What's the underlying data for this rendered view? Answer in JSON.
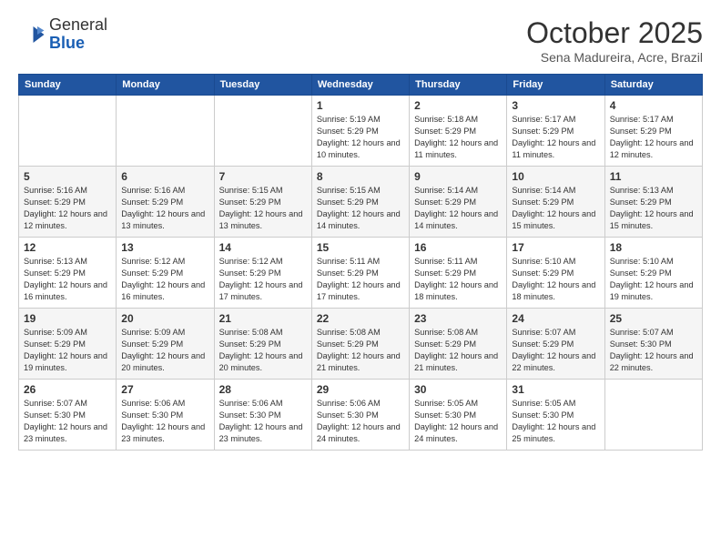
{
  "header": {
    "logo_general": "General",
    "logo_blue": "Blue",
    "month": "October 2025",
    "location": "Sena Madureira, Acre, Brazil"
  },
  "days_of_week": [
    "Sunday",
    "Monday",
    "Tuesday",
    "Wednesday",
    "Thursday",
    "Friday",
    "Saturday"
  ],
  "weeks": [
    [
      {
        "day": "",
        "info": ""
      },
      {
        "day": "",
        "info": ""
      },
      {
        "day": "",
        "info": ""
      },
      {
        "day": "1",
        "info": "Sunrise: 5:19 AM\nSunset: 5:29 PM\nDaylight: 12 hours and 10 minutes."
      },
      {
        "day": "2",
        "info": "Sunrise: 5:18 AM\nSunset: 5:29 PM\nDaylight: 12 hours and 11 minutes."
      },
      {
        "day": "3",
        "info": "Sunrise: 5:17 AM\nSunset: 5:29 PM\nDaylight: 12 hours and 11 minutes."
      },
      {
        "day": "4",
        "info": "Sunrise: 5:17 AM\nSunset: 5:29 PM\nDaylight: 12 hours and 12 minutes."
      }
    ],
    [
      {
        "day": "5",
        "info": "Sunrise: 5:16 AM\nSunset: 5:29 PM\nDaylight: 12 hours and 12 minutes."
      },
      {
        "day": "6",
        "info": "Sunrise: 5:16 AM\nSunset: 5:29 PM\nDaylight: 12 hours and 13 minutes."
      },
      {
        "day": "7",
        "info": "Sunrise: 5:15 AM\nSunset: 5:29 PM\nDaylight: 12 hours and 13 minutes."
      },
      {
        "day": "8",
        "info": "Sunrise: 5:15 AM\nSunset: 5:29 PM\nDaylight: 12 hours and 14 minutes."
      },
      {
        "day": "9",
        "info": "Sunrise: 5:14 AM\nSunset: 5:29 PM\nDaylight: 12 hours and 14 minutes."
      },
      {
        "day": "10",
        "info": "Sunrise: 5:14 AM\nSunset: 5:29 PM\nDaylight: 12 hours and 15 minutes."
      },
      {
        "day": "11",
        "info": "Sunrise: 5:13 AM\nSunset: 5:29 PM\nDaylight: 12 hours and 15 minutes."
      }
    ],
    [
      {
        "day": "12",
        "info": "Sunrise: 5:13 AM\nSunset: 5:29 PM\nDaylight: 12 hours and 16 minutes."
      },
      {
        "day": "13",
        "info": "Sunrise: 5:12 AM\nSunset: 5:29 PM\nDaylight: 12 hours and 16 minutes."
      },
      {
        "day": "14",
        "info": "Sunrise: 5:12 AM\nSunset: 5:29 PM\nDaylight: 12 hours and 17 minutes."
      },
      {
        "day": "15",
        "info": "Sunrise: 5:11 AM\nSunset: 5:29 PM\nDaylight: 12 hours and 17 minutes."
      },
      {
        "day": "16",
        "info": "Sunrise: 5:11 AM\nSunset: 5:29 PM\nDaylight: 12 hours and 18 minutes."
      },
      {
        "day": "17",
        "info": "Sunrise: 5:10 AM\nSunset: 5:29 PM\nDaylight: 12 hours and 18 minutes."
      },
      {
        "day": "18",
        "info": "Sunrise: 5:10 AM\nSunset: 5:29 PM\nDaylight: 12 hours and 19 minutes."
      }
    ],
    [
      {
        "day": "19",
        "info": "Sunrise: 5:09 AM\nSunset: 5:29 PM\nDaylight: 12 hours and 19 minutes."
      },
      {
        "day": "20",
        "info": "Sunrise: 5:09 AM\nSunset: 5:29 PM\nDaylight: 12 hours and 20 minutes."
      },
      {
        "day": "21",
        "info": "Sunrise: 5:08 AM\nSunset: 5:29 PM\nDaylight: 12 hours and 20 minutes."
      },
      {
        "day": "22",
        "info": "Sunrise: 5:08 AM\nSunset: 5:29 PM\nDaylight: 12 hours and 21 minutes."
      },
      {
        "day": "23",
        "info": "Sunrise: 5:08 AM\nSunset: 5:29 PM\nDaylight: 12 hours and 21 minutes."
      },
      {
        "day": "24",
        "info": "Sunrise: 5:07 AM\nSunset: 5:29 PM\nDaylight: 12 hours and 22 minutes."
      },
      {
        "day": "25",
        "info": "Sunrise: 5:07 AM\nSunset: 5:30 PM\nDaylight: 12 hours and 22 minutes."
      }
    ],
    [
      {
        "day": "26",
        "info": "Sunrise: 5:07 AM\nSunset: 5:30 PM\nDaylight: 12 hours and 23 minutes."
      },
      {
        "day": "27",
        "info": "Sunrise: 5:06 AM\nSunset: 5:30 PM\nDaylight: 12 hours and 23 minutes."
      },
      {
        "day": "28",
        "info": "Sunrise: 5:06 AM\nSunset: 5:30 PM\nDaylight: 12 hours and 23 minutes."
      },
      {
        "day": "29",
        "info": "Sunrise: 5:06 AM\nSunset: 5:30 PM\nDaylight: 12 hours and 24 minutes."
      },
      {
        "day": "30",
        "info": "Sunrise: 5:05 AM\nSunset: 5:30 PM\nDaylight: 12 hours and 24 minutes."
      },
      {
        "day": "31",
        "info": "Sunrise: 5:05 AM\nSunset: 5:30 PM\nDaylight: 12 hours and 25 minutes."
      },
      {
        "day": "",
        "info": ""
      }
    ]
  ]
}
